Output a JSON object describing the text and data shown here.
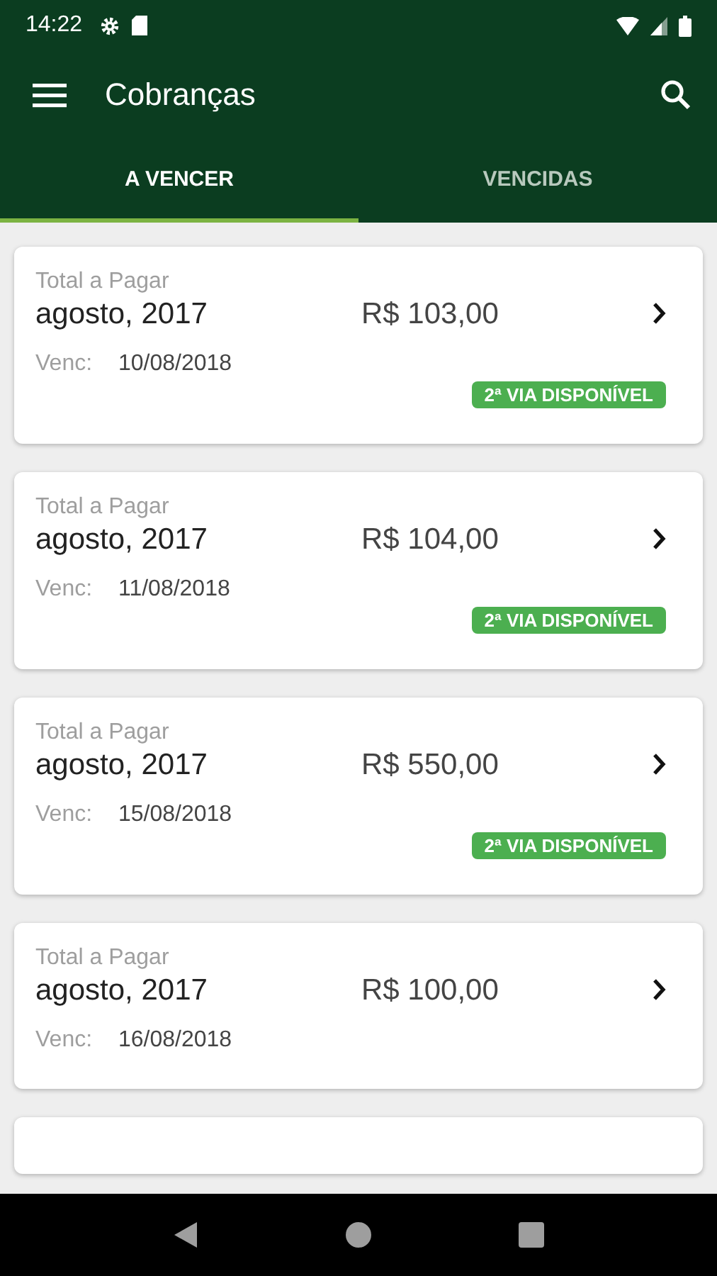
{
  "status_bar": {
    "time": "14:22"
  },
  "toolbar": {
    "title": "Cobranças"
  },
  "tabs": [
    {
      "label": "A VENCER",
      "selected": true
    },
    {
      "label": "VENCIDAS",
      "selected": false
    }
  ],
  "bills": [
    {
      "label": "Total a Pagar",
      "period": "agosto, 2017",
      "amount": "R$ 103,00",
      "due_label": "Venc:",
      "due_date": "10/08/2018",
      "badge": "2ª VIA DISPONÍVEL"
    },
    {
      "label": "Total a Pagar",
      "period": "agosto, 2017",
      "amount": "R$ 104,00",
      "due_label": "Venc:",
      "due_date": "11/08/2018",
      "badge": "2ª VIA DISPONÍVEL"
    },
    {
      "label": "Total a Pagar",
      "period": "agosto, 2017",
      "amount": "R$ 550,00",
      "due_label": "Venc:",
      "due_date": "15/08/2018",
      "badge": "2ª VIA DISPONÍVEL"
    },
    {
      "label": "Total a Pagar",
      "period": "agosto, 2017",
      "amount": "R$ 100,00",
      "due_label": "Venc:",
      "due_date": "16/08/2018"
    }
  ]
}
